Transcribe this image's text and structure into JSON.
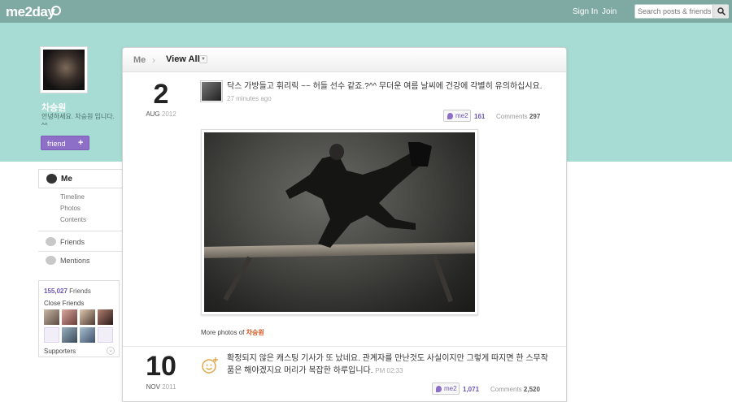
{
  "topbar": {
    "logo": "me2day",
    "sign_in": "Sign In",
    "join": "Join",
    "search_placeholder": "Search posts & friends"
  },
  "profile": {
    "name": "차승원",
    "bio": "안녕하세요. 차승원 입니다. ^^",
    "friend_button": "friend",
    "friend_plus": "+"
  },
  "nav": {
    "me": "Me",
    "sub": [
      "Timeline",
      "Photos",
      "Contents"
    ],
    "friends": "Friends",
    "mentions": "Mentions"
  },
  "friends_box": {
    "count": "155,027",
    "count_label": "Friends",
    "close_friends": "Close Friends",
    "supporters": "Supporters"
  },
  "main": {
    "breadcrumb_me": "Me",
    "breadcrumb_view": "View All",
    "posts": [
      {
        "day": "2",
        "month": "AUG",
        "year": "2012",
        "text": "닥스 가방들고 휘리릭 ~~ 허들 선수 같죠.?^^ 무더운 여름 날씨에 건강에 각별히 유의하십시요.",
        "time": "27 minutes ago",
        "me2_label": "me2",
        "me2_count": "161",
        "comments_label": "Comments",
        "comments_count": "297",
        "more_photos_label": "More photos of",
        "more_photos_name": "차승원"
      },
      {
        "day": "10",
        "month": "NOV",
        "year": "2011",
        "text": "확정되지 않은 캐스팅 기사가 또 났네요. 관계자를 만난것도 사실이지만 그렇게 따지면 한 스무작품은 해야겠지요 머리가 복잡한 하루입니다.",
        "time": "PM 02:33",
        "me2_label": "me2",
        "me2_count": "1,071",
        "comments_label": "Comments",
        "comments_count": "2,520"
      }
    ]
  },
  "colors": {
    "topbar": "#7fa9a3",
    "band": "#a6dcd4",
    "accent_purple": "#8d6fc8",
    "name_orange": "#d2541b"
  }
}
